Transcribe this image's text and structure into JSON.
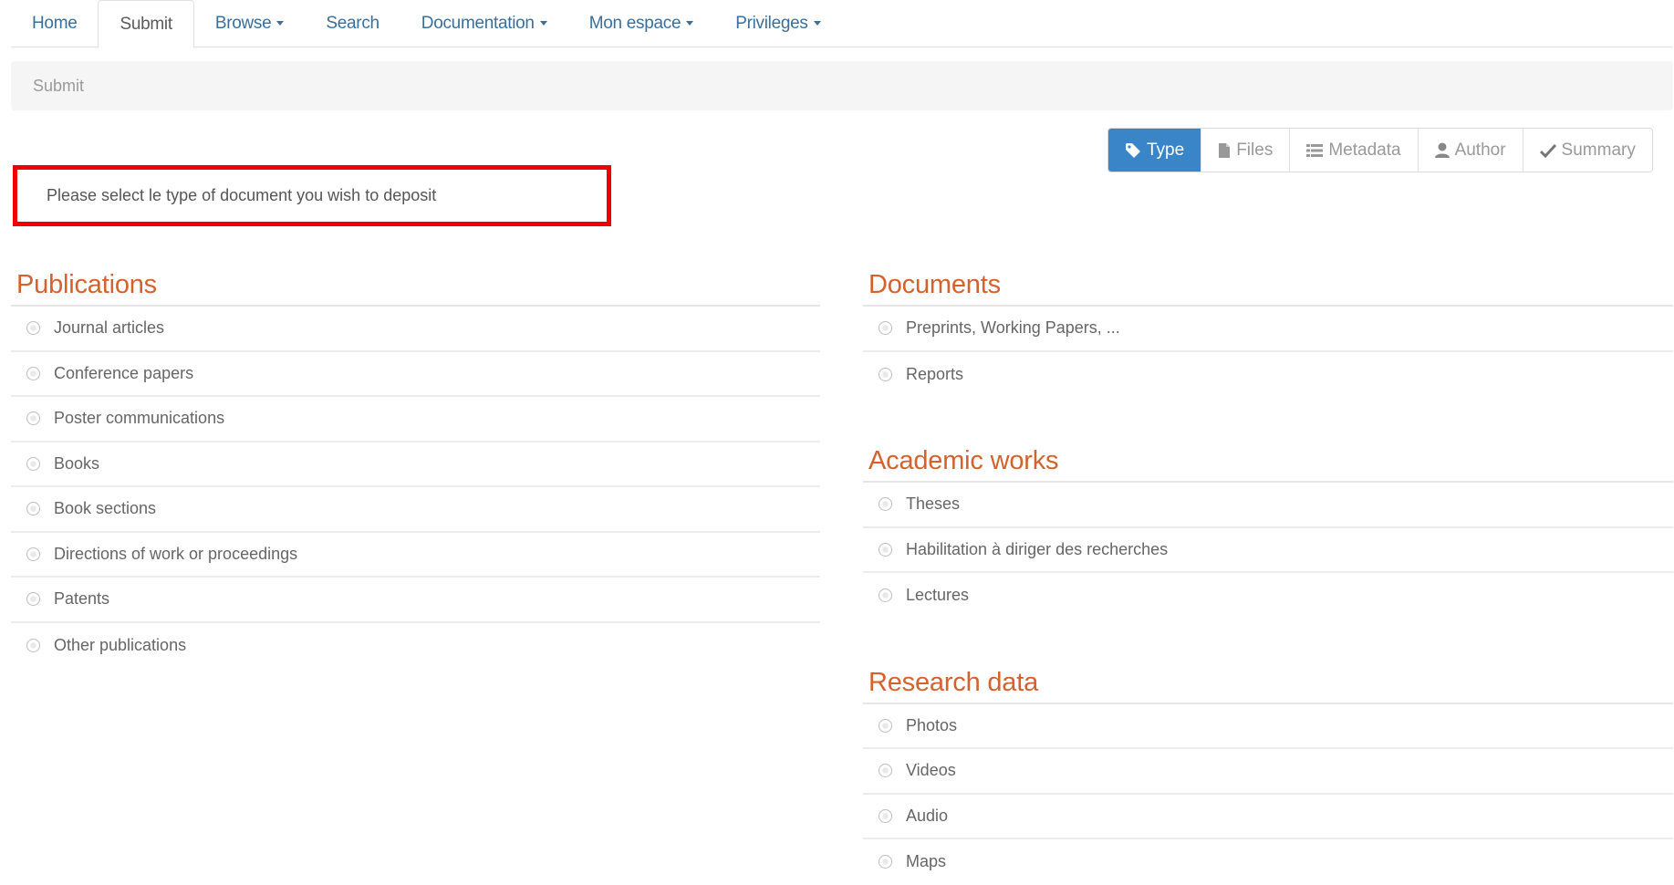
{
  "nav": {
    "home": "Home",
    "submit": "Submit",
    "browse": "Browse",
    "search": "Search",
    "documentation": "Documentation",
    "mon_espace": "Mon espace",
    "privileges": "Privileges"
  },
  "breadcrumb": {
    "current": "Submit"
  },
  "steps": {
    "type": "Type",
    "files": "Files",
    "metadata": "Metadata",
    "author": "Author",
    "summary": "Summary"
  },
  "instruction": "Please select le type of document you wish to deposit",
  "publications": {
    "title": "Publications",
    "items": [
      "Journal articles",
      "Conference papers",
      "Poster communications",
      "Books",
      "Book sections",
      "Directions of work or proceedings",
      "Patents",
      "Other publications"
    ]
  },
  "documents": {
    "title": "Documents",
    "items": [
      "Preprints, Working Papers, ...",
      "Reports"
    ]
  },
  "academic": {
    "title": "Academic works",
    "items": [
      "Theses",
      "Habilitation à diriger des recherches",
      "Lectures"
    ]
  },
  "research": {
    "title": "Research data",
    "items": [
      "Photos",
      "Videos",
      "Audio",
      "Maps"
    ]
  },
  "colors": {
    "accent": "#3a85c7",
    "section_title": "#d4622e",
    "highlight_border": "#ee0000",
    "nav_link": "#3a6f9c"
  }
}
